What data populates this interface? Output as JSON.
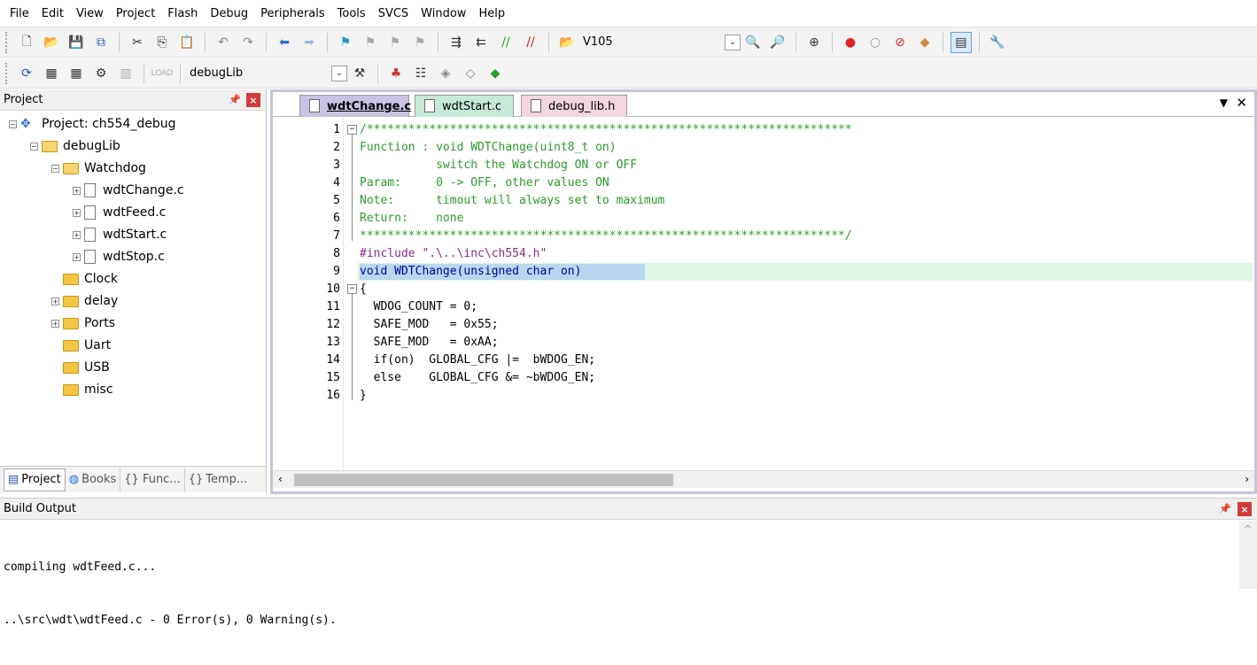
{
  "menu": [
    "File",
    "Edit",
    "View",
    "Project",
    "Flash",
    "Debug",
    "Peripherals",
    "Tools",
    "SVCS",
    "Window",
    "Help"
  ],
  "toolbar1": {
    "target_combo": "V105"
  },
  "toolbar2": {
    "target_combo": "debugLib"
  },
  "project_panel": {
    "title": "Project",
    "tree": [
      {
        "label": "Project: ch554_debug",
        "depth": 0,
        "kind": "project",
        "expander": "-"
      },
      {
        "label": "debugLib",
        "depth": 1,
        "kind": "group",
        "expander": "-"
      },
      {
        "label": "Watchdog",
        "depth": 2,
        "kind": "folder-open",
        "expander": "-"
      },
      {
        "label": "wdtChange.c",
        "depth": 3,
        "kind": "file",
        "expander": "+"
      },
      {
        "label": "wdtFeed.c",
        "depth": 3,
        "kind": "file",
        "expander": "+"
      },
      {
        "label": "wdtStart.c",
        "depth": 3,
        "kind": "file",
        "expander": "+"
      },
      {
        "label": "wdtStop.c",
        "depth": 3,
        "kind": "file",
        "expander": "+"
      },
      {
        "label": "Clock",
        "depth": 2,
        "kind": "folder",
        "expander": ""
      },
      {
        "label": "delay",
        "depth": 2,
        "kind": "folder",
        "expander": "+"
      },
      {
        "label": "Ports",
        "depth": 2,
        "kind": "folder",
        "expander": "+"
      },
      {
        "label": "Uart",
        "depth": 2,
        "kind": "folder",
        "expander": ""
      },
      {
        "label": "USB",
        "depth": 2,
        "kind": "folder",
        "expander": ""
      },
      {
        "label": "misc",
        "depth": 2,
        "kind": "folder",
        "expander": ""
      }
    ],
    "tabs": [
      "Project",
      "Books",
      "{} Func...",
      "Temp..."
    ]
  },
  "editor": {
    "tabs": [
      {
        "label": "wdtChange.c",
        "active": true,
        "color": "#c9c2e3"
      },
      {
        "label": "wdtStart.c",
        "active": false,
        "color": "#c7ead8"
      },
      {
        "label": "debug_lib.h",
        "active": false,
        "color": "#f3d6e2"
      }
    ],
    "lines": [
      {
        "n": "1",
        "text": "/**********************************************************************",
        "color": "#2a9d2a",
        "fold": "-"
      },
      {
        "n": "2",
        "text": "Function : void WDTChange(uint8_t on)",
        "color": "#2a9d2a"
      },
      {
        "n": "3",
        "text": "           switch the Watchdog ON or OFF",
        "color": "#2a9d2a"
      },
      {
        "n": "4",
        "text": "Param:     0 -> OFF, other values ON",
        "color": "#2a9d2a"
      },
      {
        "n": "5",
        "text": "Note:      timout will always set to maximum",
        "color": "#2a9d2a"
      },
      {
        "n": "6",
        "text": "Return:    none",
        "color": "#2a9d2a"
      },
      {
        "n": "7",
        "text": "**********************************************************************/",
        "color": "#2a9d2a"
      },
      {
        "n": "8",
        "text": "#include \".\\..\\inc\\ch554.h\"",
        "color": "#8b2a8b"
      },
      {
        "n": "9",
        "text": "void WDTChange(unsigned char on)",
        "color": "#0000a0",
        "highlight": true
      },
      {
        "n": "10",
        "text": "{",
        "color": "#000000",
        "fold": "-"
      },
      {
        "n": "11",
        "text": "  WDOG_COUNT = 0;",
        "color": "#000000"
      },
      {
        "n": "12",
        "text": "  SAFE_MOD   = 0x55;",
        "color": "#000000"
      },
      {
        "n": "13",
        "text": "  SAFE_MOD   = 0xAA;",
        "color": "#000000"
      },
      {
        "n": "14",
        "text": "  if(on)  GLOBAL_CFG |=  bWDOG_EN;",
        "color": "#000000"
      },
      {
        "n": "15",
        "text": "  else    GLOBAL_CFG &= ~bWDOG_EN;",
        "color": "#000000"
      },
      {
        "n": "16",
        "text": "}",
        "color": "#000000"
      }
    ]
  },
  "build_output": {
    "title": "Build Output",
    "lines": [
      "compiling wdtFeed.c...",
      "..\\src\\wdt\\wdtFeed.c - 0 Error(s), 0 Warning(s)."
    ]
  }
}
